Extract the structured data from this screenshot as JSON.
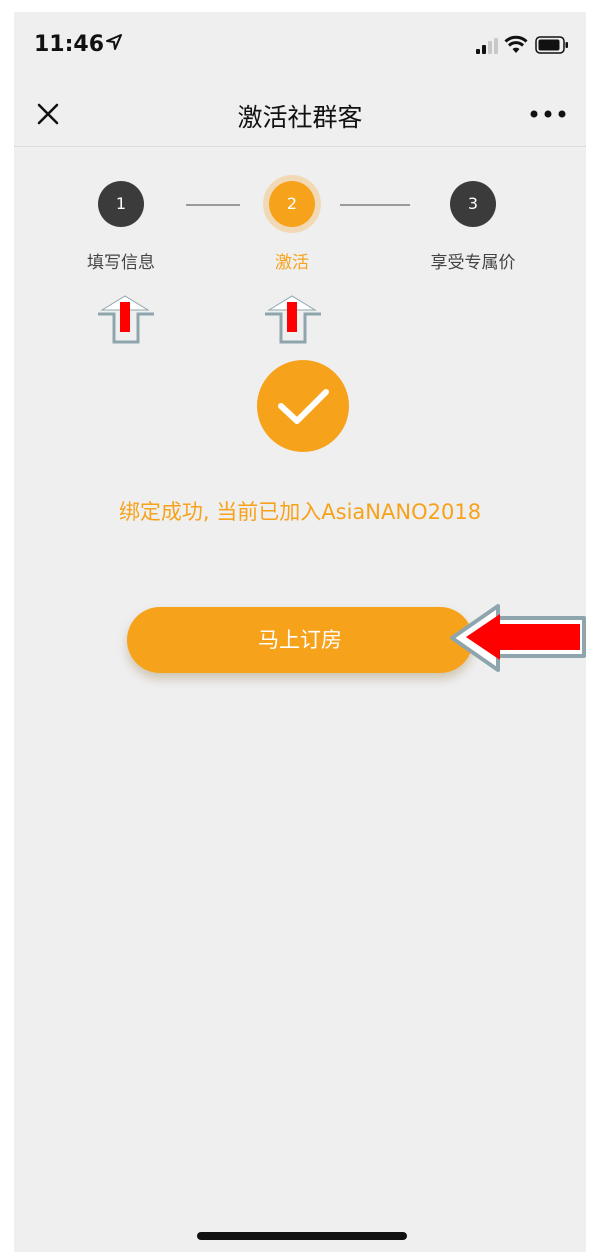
{
  "status_bar": {
    "time": "11:46",
    "icons": [
      "location-arrow-icon",
      "signal-icon",
      "wifi-icon",
      "battery-icon"
    ]
  },
  "nav": {
    "title": "激活社群客",
    "close_icon": "close-icon",
    "more_icon": "more-icon"
  },
  "steps": [
    {
      "number": "1",
      "label": "填写信息",
      "active": false
    },
    {
      "number": "2",
      "label": "激活",
      "active": true
    },
    {
      "number": "3",
      "label": "享受专属价",
      "active": false
    }
  ],
  "success": {
    "icon": "checkmark-icon",
    "message": "绑定成功, 当前已加入AsiaNANO2018"
  },
  "action": {
    "book_label": "马上订房"
  },
  "colors": {
    "accent": "#f7a21b",
    "step_dark": "#3b3b3b",
    "background": "#efeff0",
    "annotation_red": "#ff0000"
  }
}
